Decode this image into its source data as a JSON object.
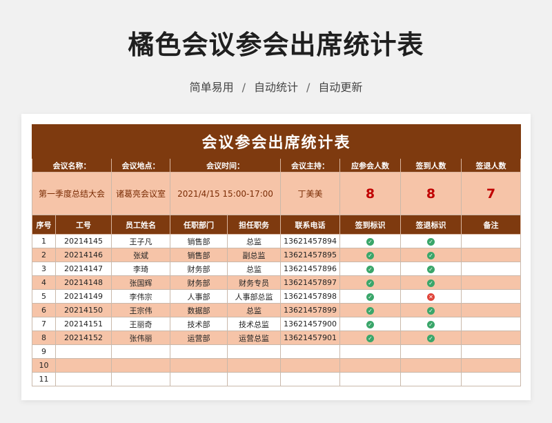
{
  "header": {
    "title": "橘色会议参会出席统计表",
    "features": [
      "简单易用",
      "自动统计",
      "自动更新"
    ],
    "separator": "/"
  },
  "sheet": {
    "title": "会议参会出席统计表",
    "info_labels": [
      "会议名称：",
      "会议地点：",
      "会议时间：",
      "会议主持：",
      "应参会人数",
      "签到人数",
      "签退人数"
    ],
    "info_values": {
      "name": "第一季度总结大会",
      "location": "诸葛亮会议室",
      "time": "2021/4/15   15:00-17:00",
      "host": "丁美美",
      "expected": "8",
      "signed_in": "8",
      "signed_out": "7"
    },
    "columns": [
      "序号",
      "工号",
      "员工姓名",
      "任职部门",
      "担任职务",
      "联系电话",
      "签到标识",
      "签退标识",
      "备注"
    ],
    "icons": {
      "ok": "check-circle-icon",
      "no": "cross-circle-icon",
      "ok_color": "#3aa66a",
      "no_color": "#e0443a"
    },
    "rows": [
      {
        "no": "1",
        "id": "20214145",
        "name": "王子凡",
        "dept": "销售部",
        "role": "总监",
        "phone": "13621457894",
        "in": "ok",
        "out": "ok",
        "note": ""
      },
      {
        "no": "2",
        "id": "20214146",
        "name": "张斌",
        "dept": "销售部",
        "role": "副总监",
        "phone": "13621457895",
        "in": "ok",
        "out": "ok",
        "note": ""
      },
      {
        "no": "3",
        "id": "20214147",
        "name": "李琦",
        "dept": "财务部",
        "role": "总监",
        "phone": "13621457896",
        "in": "ok",
        "out": "ok",
        "note": ""
      },
      {
        "no": "4",
        "id": "20214148",
        "name": "张国辉",
        "dept": "财务部",
        "role": "财务专员",
        "phone": "13621457897",
        "in": "ok",
        "out": "ok",
        "note": ""
      },
      {
        "no": "5",
        "id": "20214149",
        "name": "李伟宗",
        "dept": "人事部",
        "role": "人事部总监",
        "phone": "13621457898",
        "in": "ok",
        "out": "no",
        "note": ""
      },
      {
        "no": "6",
        "id": "20214150",
        "name": "王宗伟",
        "dept": "数据部",
        "role": "总监",
        "phone": "13621457899",
        "in": "ok",
        "out": "ok",
        "note": ""
      },
      {
        "no": "7",
        "id": "20214151",
        "name": "王丽奇",
        "dept": "技术部",
        "role": "技术总监",
        "phone": "13621457900",
        "in": "ok",
        "out": "ok",
        "note": ""
      },
      {
        "no": "8",
        "id": "20214152",
        "name": "张伟丽",
        "dept": "运营部",
        "role": "运营总监",
        "phone": "13621457901",
        "in": "ok",
        "out": "ok",
        "note": ""
      },
      {
        "no": "9",
        "id": "",
        "name": "",
        "dept": "",
        "role": "",
        "phone": "",
        "in": "",
        "out": "",
        "note": ""
      },
      {
        "no": "10",
        "id": "",
        "name": "",
        "dept": "",
        "role": "",
        "phone": "",
        "in": "",
        "out": "",
        "note": ""
      },
      {
        "no": "11",
        "id": "",
        "name": "",
        "dept": "",
        "role": "",
        "phone": "",
        "in": "",
        "out": "",
        "note": ""
      }
    ]
  }
}
